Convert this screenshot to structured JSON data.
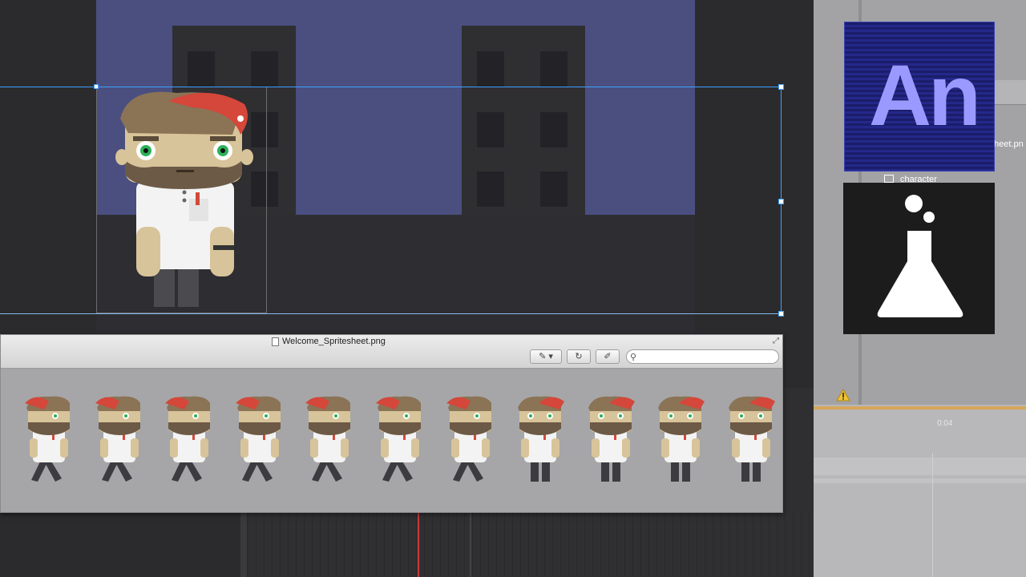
{
  "sprite_window": {
    "title": "Welcome_Spritesheet.png",
    "frame_count": 11,
    "search": {
      "placeholder": ""
    }
  },
  "right_panel": {
    "file_fragment": "heet.pn",
    "symbol_label": "character",
    "timeline_marker": "0:04"
  },
  "logos": {
    "animate_logo_text": "An",
    "flask_icon": "flask-icon"
  },
  "colors": {
    "sky": "#4a4f80",
    "selection": "#3fa0ff",
    "animate_brand": "#9a99ff"
  }
}
